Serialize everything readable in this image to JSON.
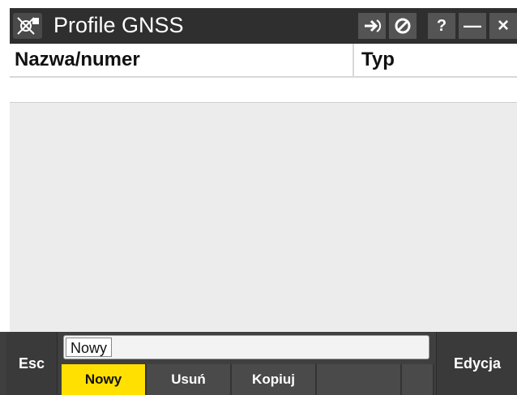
{
  "window": {
    "title": "Profile GNSS"
  },
  "titlebar_buttons": [
    {
      "name": "forward-icon"
    },
    {
      "name": "no-entry-icon"
    },
    {
      "label": "?"
    },
    {
      "label": "—"
    },
    {
      "label": "×"
    }
  ],
  "table": {
    "columns": [
      "Nazwa/numer",
      "Typ"
    ],
    "rows": []
  },
  "bottombar": {
    "esc": "Esc",
    "input_value": "Nowy",
    "softkeys": [
      "Nowy",
      "Usuń",
      "Kopiuj",
      "",
      ""
    ],
    "edit": "Edycja"
  },
  "colors": {
    "titlebar": "#2f2f2f",
    "active_softkey": "#ffe000",
    "toolbar": "#3f3f3f"
  }
}
